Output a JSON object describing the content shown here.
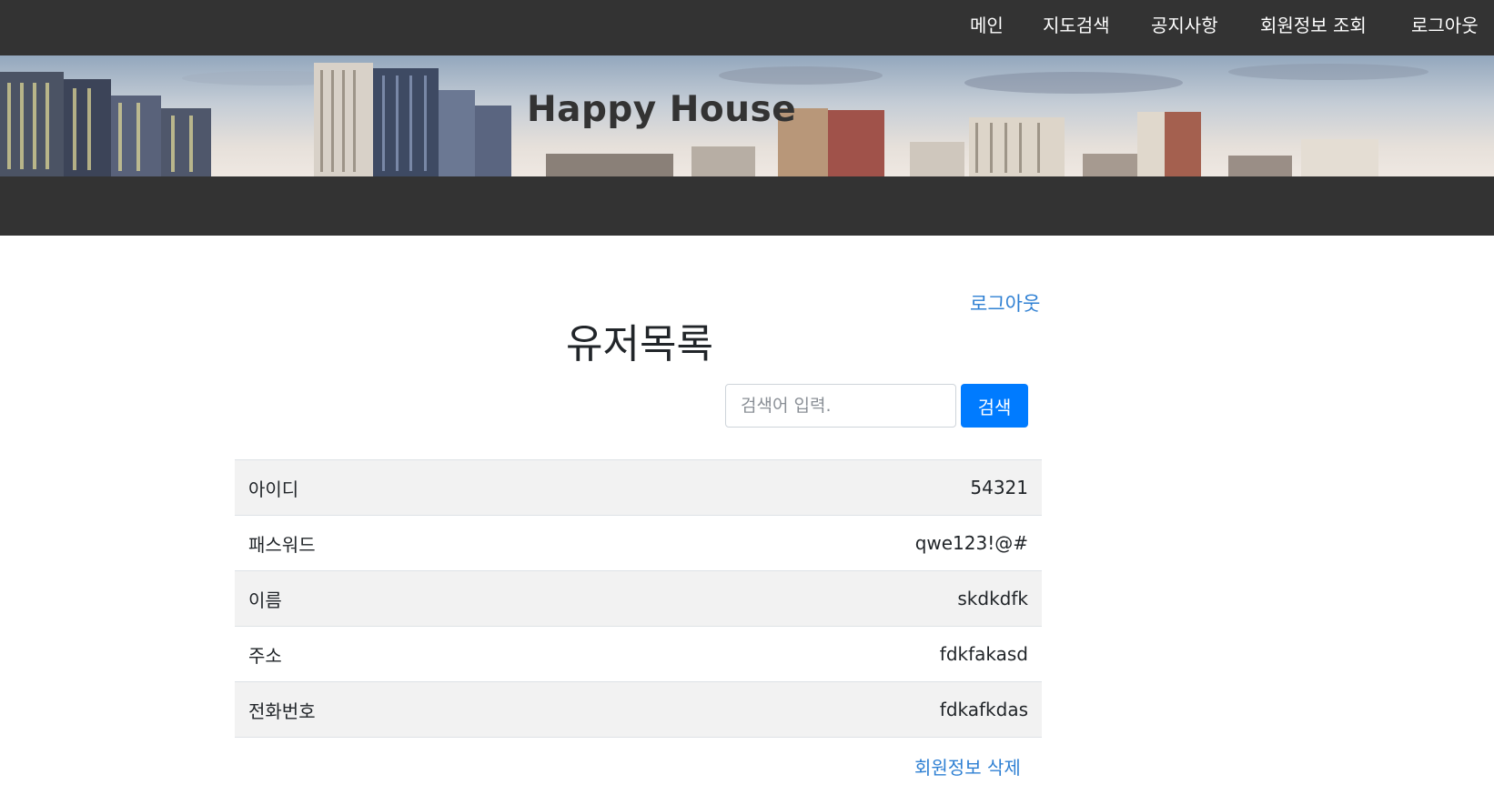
{
  "nav": {
    "items": [
      {
        "label": "메인"
      },
      {
        "label": "지도검색"
      },
      {
        "label": "공지사항"
      },
      {
        "label": "회원정보 조회"
      },
      {
        "label": "로그아웃"
      }
    ]
  },
  "hero": {
    "title": "Happy House"
  },
  "main": {
    "logout_label": "로그아웃",
    "title": "유저목록",
    "search": {
      "placeholder": "검색어 입력.",
      "value": "",
      "button_label": "검색"
    },
    "user_info": [
      {
        "label": "아이디",
        "value": "54321"
      },
      {
        "label": "패스워드",
        "value": "qwe123!@#"
      },
      {
        "label": "이름",
        "value": "skdkdfk"
      },
      {
        "label": "주소",
        "value": "fdkfakasd"
      },
      {
        "label": "전화번호",
        "value": "fdkafkdas"
      }
    ],
    "delete_label": "회원정보 삭제"
  },
  "colors": {
    "nav_background": "#333333",
    "accent": "#007bff",
    "link": "#2f80d3",
    "stripe": "#f2f2f2"
  }
}
